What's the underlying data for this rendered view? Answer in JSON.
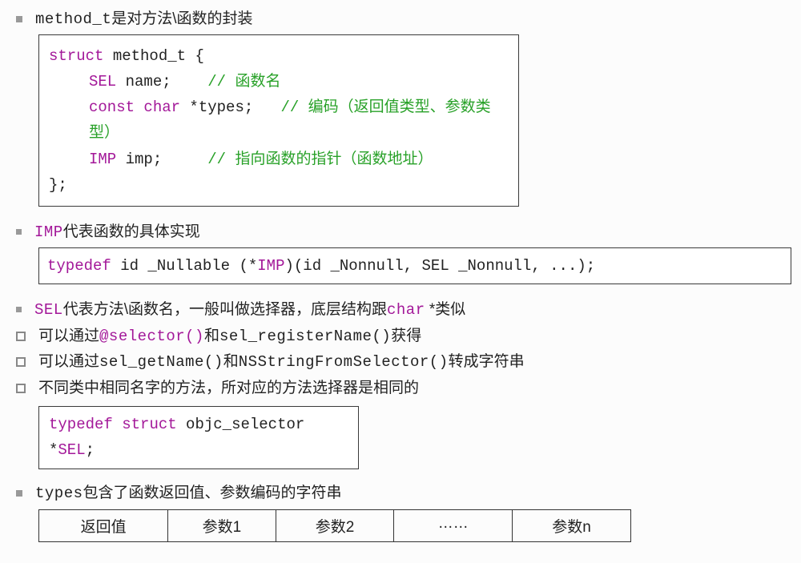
{
  "s1": {
    "heading_code": "method_t",
    "heading_txt": "是对方法\\函数的封装",
    "code": {
      "line1a": "struct",
      "line1b": " method_t {",
      "line2a": "SEL",
      "line2b": " name;",
      "line2c": "// 函数名",
      "line3a": "const",
      "line3b": "char",
      "line3c": " *types;",
      "line3d": "// 编码（返回值类型、参数类型）",
      "line4a": "IMP",
      "line4b": " imp;",
      "line4c": "// 指向函数的指针（函数地址）",
      "line5": "};"
    }
  },
  "s2": {
    "heading_code": "IMP",
    "heading_txt": "代表函数的具体实现",
    "code_parts": {
      "a": "typedef",
      "b": " id _Nullable (*",
      "c": "IMP",
      "d": ")(id _Nonnull, SEL _Nonnull, ...);"
    }
  },
  "s3": {
    "heading_code": "SEL",
    "heading_txt1": "代表方法\\函数名，一般叫做选择器，底层结构跟",
    "heading_code2": "char",
    "heading_txt2": " *类似",
    "sub1_a": "可以通过",
    "sub1_b": "@selector()",
    "sub1_c": "和",
    "sub1_d": "sel_registerName()",
    "sub1_e": "获得",
    "sub2_a": "可以通过",
    "sub2_b": "sel_getName()",
    "sub2_c": "和",
    "sub2_d": "NSStringFromSelector()",
    "sub2_e": "转成字符串",
    "sub3": "不同类中相同名字的方法，所对应的方法选择器是相同的",
    "code_parts": {
      "a": "typedef",
      "b": "struct",
      "c": " objc_selector *",
      "d": "SEL",
      "e": ";"
    }
  },
  "s4": {
    "heading_code": "types",
    "heading_txt": "包含了函数返回值、参数编码的字符串",
    "cells": [
      "返回值",
      "参数1",
      "参数2",
      "……",
      "参数n"
    ]
  }
}
